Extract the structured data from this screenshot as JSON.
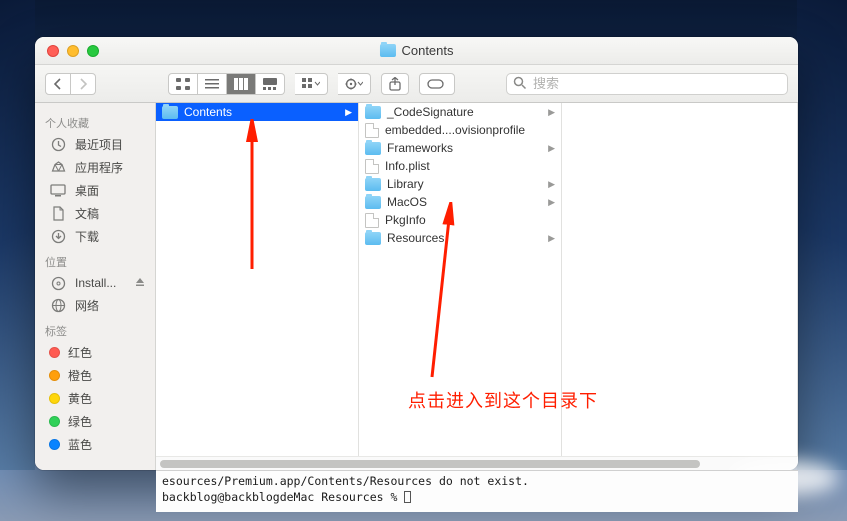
{
  "window": {
    "title": "Contents"
  },
  "toolbar": {
    "search_placeholder": "搜索"
  },
  "sidebar": {
    "sections": [
      {
        "header": "个人收藏",
        "items": [
          {
            "label": "最近项目",
            "icon": "clock-icon"
          },
          {
            "label": "应用程序",
            "icon": "app-icon"
          },
          {
            "label": "桌面",
            "icon": "desktop-icon"
          },
          {
            "label": "文稿",
            "icon": "documents-icon"
          },
          {
            "label": "下载",
            "icon": "downloads-icon"
          }
        ]
      },
      {
        "header": "位置",
        "items": [
          {
            "label": "Install...",
            "icon": "disk-icon",
            "eject": true
          },
          {
            "label": "网络",
            "icon": "network-icon"
          }
        ]
      },
      {
        "header": "标签",
        "items": [
          {
            "label": "红色",
            "color": "#ff5b52"
          },
          {
            "label": "橙色",
            "color": "#ff9f0a"
          },
          {
            "label": "黄色",
            "color": "#ffd60a"
          },
          {
            "label": "绿色",
            "color": "#30d158"
          },
          {
            "label": "蓝色",
            "color": "#0a84ff"
          }
        ]
      }
    ]
  },
  "columns": {
    "col1": [
      {
        "name": "Contents",
        "type": "folder",
        "selected": true,
        "expandable": true
      }
    ],
    "col2": [
      {
        "name": "_CodeSignature",
        "type": "folder",
        "expandable": true
      },
      {
        "name": "embedded....ovisionprofile",
        "type": "file"
      },
      {
        "name": "Frameworks",
        "type": "folder",
        "expandable": true
      },
      {
        "name": "Info.plist",
        "type": "file"
      },
      {
        "name": "Library",
        "type": "folder",
        "expandable": true
      },
      {
        "name": "MacOS",
        "type": "folder",
        "expandable": true
      },
      {
        "name": "PkgInfo",
        "type": "file"
      },
      {
        "name": "Resources",
        "type": "folder",
        "expandable": true
      }
    ]
  },
  "annotation": {
    "text": "点击进入到这个目录下",
    "arrow_color": "#ff1e00"
  },
  "terminal": {
    "line1": "esources/Premium.app/Contents/Resources do not exist.",
    "line2_prompt": "backblog@backblogdeMac Resources % "
  }
}
